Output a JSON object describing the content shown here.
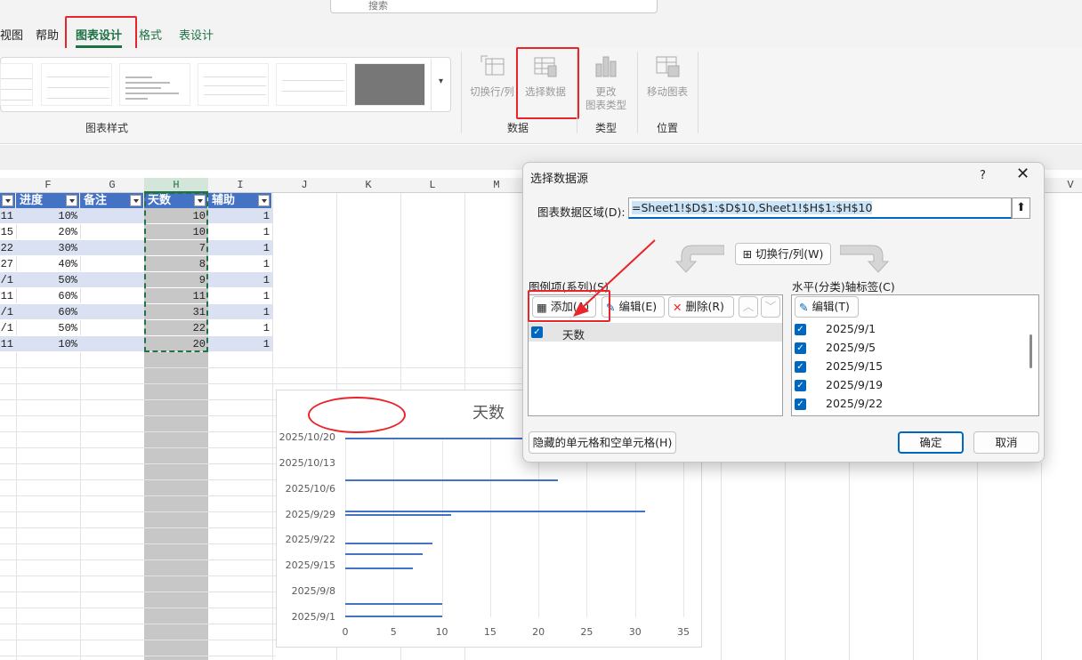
{
  "search": {
    "placeholder": "搜索"
  },
  "tabs": [
    {
      "label": "视图"
    },
    {
      "label": "帮助"
    },
    {
      "label": "图表设计",
      "active": true
    },
    {
      "label": "格式"
    },
    {
      "label": "表设计"
    }
  ],
  "ribbon": {
    "groups": {
      "chart_styles": "图表样式",
      "data": "数据",
      "type": "类型",
      "location": "位置"
    },
    "buttons": {
      "switch_row_col": "切换行/列",
      "select_data": "选择数据",
      "change_type_1": "更改",
      "change_type_2": "图表类型",
      "move_chart": "移动图表"
    }
  },
  "columns": [
    "F",
    "G",
    "H",
    "I",
    "J",
    "K",
    "L",
    "M",
    "V"
  ],
  "table": {
    "headers": [
      "进度",
      "备注",
      "天数",
      "辅助"
    ],
    "rows": [
      {
        "e": "11",
        "f": "10%",
        "h": "10",
        "i": "1"
      },
      {
        "e": "15",
        "f": "20%",
        "h": "10",
        "i": "1"
      },
      {
        "e": "22",
        "f": "30%",
        "h": "7",
        "i": "1"
      },
      {
        "e": "27",
        "f": "40%",
        "h": "8",
        "i": "1"
      },
      {
        "e": "/1",
        "f": "50%",
        "h": "9",
        "i": "1"
      },
      {
        "e": "11",
        "f": "60%",
        "h": "11",
        "i": "1"
      },
      {
        "e": "/1",
        "f": "60%",
        "h": "31",
        "i": "1"
      },
      {
        "e": "/1",
        "f": "50%",
        "h": "22",
        "i": "1"
      },
      {
        "e": "11",
        "f": "10%",
        "h": "20",
        "i": "1"
      }
    ]
  },
  "chart_data": {
    "type": "bar",
    "title": "天数",
    "y_tick_labels": [
      "2025/10/20",
      "2025/10/13",
      "2025/10/6",
      "2025/9/29",
      "2025/9/22",
      "2025/9/15",
      "2025/9/8",
      "2025/9/1"
    ],
    "x_tick_labels": [
      "0",
      "5",
      "10",
      "15",
      "20",
      "25",
      "30",
      "35"
    ],
    "xlim": [
      0,
      35
    ],
    "series": [
      {
        "values": [
          10,
          10,
          7,
          8,
          9,
          11,
          31,
          22,
          20
        ]
      }
    ]
  },
  "dialog": {
    "title": "选择数据源",
    "help": "?",
    "close": "✕",
    "range_label": "图表数据区域(D):",
    "range_value": "=Sheet1!$D$1:$D$10,Sheet1!$H$1:$H$10",
    "switch_btn": "切换行/列(W)",
    "series_label": "图例项(系列)(S)",
    "axis_label": "水平(分类)轴标签(C)",
    "add_btn": "添加(A)",
    "edit_btn": "编辑(E)",
    "delete_btn": "删除(R)",
    "axis_edit_btn": "编辑(T)",
    "series": [
      {
        "name": "天数",
        "checked": true
      }
    ],
    "categories": [
      "2025/9/1",
      "2025/9/5",
      "2025/9/15",
      "2025/9/19",
      "2025/9/22"
    ],
    "hidden_btn": "隐藏的单元格和空单元格(H)",
    "ok": "确定",
    "cancel": "取消"
  },
  "colors": {
    "accent": "#1e7145",
    "table_header": "#4472c4",
    "band": "#d9e1f2",
    "bar": "#4472c4",
    "highlight": "#e8252a",
    "dialog_primary": "#0067c0"
  }
}
